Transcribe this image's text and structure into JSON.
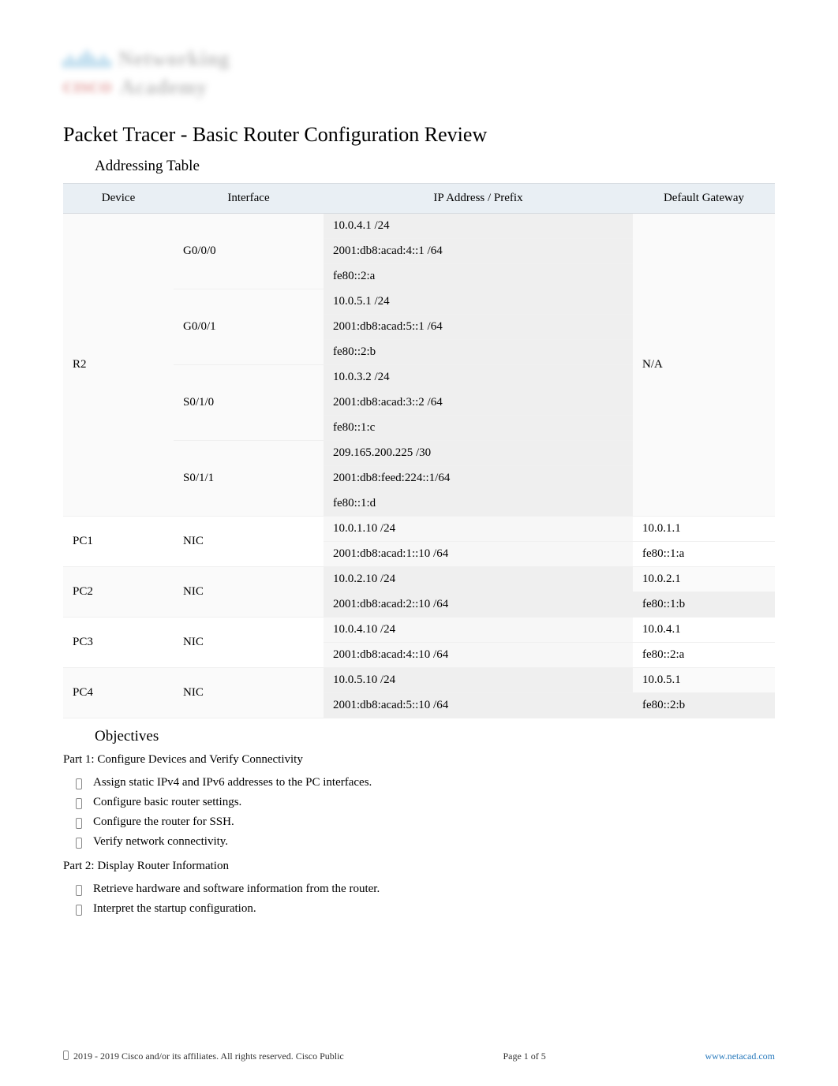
{
  "logo": {
    "top_text": "Networking",
    "vendor": "CISCO",
    "bottom_text": "Academy"
  },
  "title": "Packet Tracer - Basic Router Configuration Review",
  "addressing_table_heading": "Addressing Table",
  "table": {
    "headers": {
      "device": "Device",
      "interface": "Interface",
      "ip": "IP Address / Prefix",
      "gateway": "Default Gateway"
    },
    "rows": [
      {
        "device": "R2",
        "interface": "G0/0/0",
        "addresses": [
          "10.0.4.1 /24",
          "2001:db8:acad:4::1 /64",
          "fe80::2:a"
        ],
        "gateway": "N/A",
        "group": "odd"
      },
      {
        "device": "",
        "interface": "G0/0/1",
        "addresses": [
          "10.0.5.1 /24",
          "2001:db8:acad:5::1 /64",
          "fe80::2:b"
        ],
        "gateway": "",
        "group": "odd"
      },
      {
        "device": "",
        "interface": "S0/1/0",
        "addresses": [
          "10.0.3.2 /24",
          "2001:db8:acad:3::2 /64",
          "fe80::1:c"
        ],
        "gateway": "",
        "group": "odd"
      },
      {
        "device": "",
        "interface": "S0/1/1",
        "addresses": [
          "209.165.200.225 /30",
          "2001:db8:feed:224::1/64",
          "fe80::1:d"
        ],
        "gateway": "",
        "group": "odd"
      },
      {
        "device": "PC1",
        "interface": "NIC",
        "addresses": [
          "10.0.1.10 /24",
          "2001:db8:acad:1::10 /64"
        ],
        "gateways": [
          "10.0.1.1",
          "fe80::1:a"
        ],
        "group": "even"
      },
      {
        "device": "PC2",
        "interface": "NIC",
        "addresses": [
          "10.0.2.10 /24",
          "2001:db8:acad:2::10 /64"
        ],
        "gateways": [
          "10.0.2.1",
          "fe80::1:b"
        ],
        "group": "odd"
      },
      {
        "device": "PC3",
        "interface": "NIC",
        "addresses": [
          "10.0.4.10 /24",
          "2001:db8:acad:4::10 /64"
        ],
        "gateways": [
          "10.0.4.1",
          "fe80::2:a"
        ],
        "group": "even"
      },
      {
        "device": "PC4",
        "interface": "NIC",
        "addresses": [
          "10.0.5.10 /24",
          "2001:db8:acad:5::10 /64"
        ],
        "gateways": [
          "10.0.5.1",
          "fe80::2:b"
        ],
        "group": "odd"
      }
    ]
  },
  "objectives": {
    "heading": "Objectives",
    "part1": {
      "title": "Part 1: Configure Devices and Verify Connectivity",
      "items": [
        "Assign static IPv4 and IPv6 addresses to the PC interfaces.",
        "Configure basic router settings.",
        "Configure the router for SSH.",
        "Verify network connectivity."
      ]
    },
    "part2": {
      "title": "Part 2: Display Router Information",
      "items": [
        "Retrieve hardware and software information from the router.",
        "Interpret the startup configuration."
      ]
    }
  },
  "footer": {
    "copyright": "2019 - 2019 Cisco and/or its affiliates. All rights reserved. Cisco Public",
    "page": "Page  1  of 5",
    "link": "www.netacad.com"
  }
}
